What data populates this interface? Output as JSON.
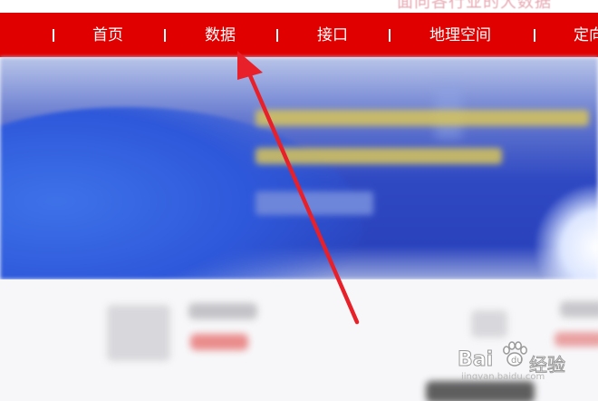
{
  "header_ghost_text": "面向各行业的大数据",
  "nav": {
    "items": [
      {
        "label": "首页"
      },
      {
        "label": "数据"
      },
      {
        "label": "接口"
      },
      {
        "label": "地理空间"
      },
      {
        "label": "定向"
      }
    ],
    "background_color": "#e00000",
    "text_color": "#ffffff"
  },
  "annotation": {
    "arrow_color": "#e8202a",
    "points_to": "数据"
  },
  "watermark": {
    "brand": "Bai",
    "brand_tail": "经验",
    "url": "jingyan.baidu.com"
  }
}
